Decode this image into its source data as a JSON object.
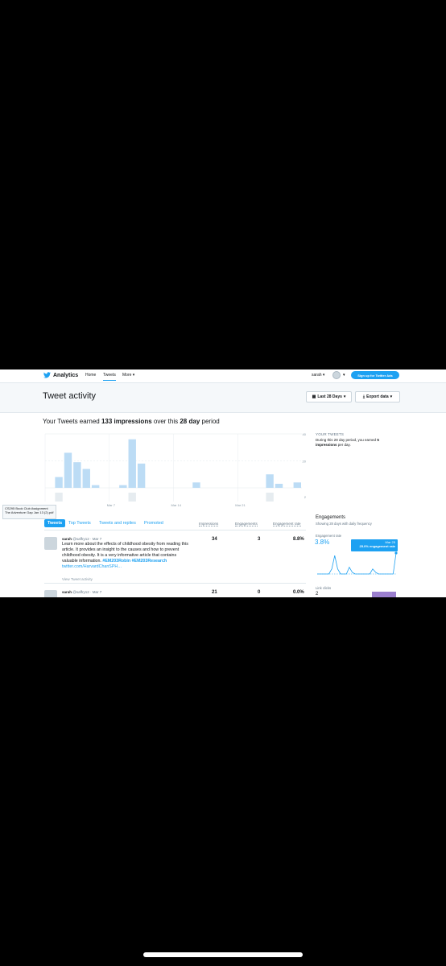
{
  "nav": {
    "brand": "Analytics",
    "links": [
      "Home",
      "Tweets",
      "More"
    ],
    "active_link": "Tweets",
    "user": "sarah",
    "ads_button": "Sign up for Twitter Ads"
  },
  "header": {
    "title": "Tweet activity",
    "date_range": "Last 28 Days",
    "export": "Export data"
  },
  "summary": {
    "prefix": "Your Tweets earned",
    "impressions": "133 impressions",
    "middle": "over this",
    "period": "28 day",
    "suffix": "period"
  },
  "chart_data": {
    "type": "bar",
    "y_ticks": [
      "40",
      "20",
      "2"
    ],
    "x_tick_labels": [
      "Mar 7",
      "Mar 14",
      "Mar 21"
    ],
    "impressions": [
      0,
      8,
      26,
      19,
      14,
      2,
      0,
      0,
      2,
      36,
      18,
      0,
      0,
      0,
      0,
      0,
      4,
      0,
      0,
      0,
      0,
      0,
      0,
      0,
      10,
      3,
      0,
      4
    ],
    "organic_bars": [
      0,
      6,
      0,
      0,
      0,
      0,
      0,
      0,
      0,
      6,
      0,
      0,
      0,
      0,
      0,
      0,
      0,
      0,
      0,
      0,
      0,
      0,
      0,
      0,
      6,
      0,
      0,
      0
    ],
    "ylim": [
      0,
      40
    ],
    "grid": true
  },
  "your_tweets": {
    "heading": "YOUR TWEETS",
    "text_pre": "During this 28 day period, you earned",
    "value": "5 impressions",
    "text_post": "per day."
  },
  "file_tooltip": "CS295 Book Club Assignment The Adventure Gap Jan 13 (2).pdf",
  "tabs": [
    "Tweets",
    "Top Tweets",
    "Tweets and replies",
    "Promoted"
  ],
  "columns": [
    "Impressions",
    "Engagements",
    "Engagement rate"
  ],
  "tweets": [
    {
      "name": "sarah",
      "handle": "@saffry12 · Mar 7",
      "text": "Learn more about the effects of childhood obesity from reading this article. It provides an insight to the causes and how to prevent childhood obesity. It is a very informative article that contains valuable information.",
      "hashtag1": "#EM203Robin",
      "hashtag2": "#EM203Research",
      "link": "twitter.com/HarvardChanSPH…",
      "activity": "View Tweet activity",
      "impressions": "34",
      "engagements": "3",
      "rate": "8.8%"
    },
    {
      "name": "sarah",
      "handle": "@saffry12 · Mar 7",
      "impressions": "21",
      "engagements": "0",
      "rate": "0.0%"
    }
  ],
  "engagements": {
    "heading": "Engagements",
    "sub": "Showing 28 days with daily frequency",
    "rate_label": "Engagement rate",
    "rate": "3.8%",
    "tip_date": "Mar 25",
    "tip_value": "25.0% engagement rate",
    "sparkline": [
      0,
      0,
      0,
      0,
      0,
      6,
      22,
      6,
      0,
      0,
      0,
      8,
      2,
      0,
      0,
      0,
      0,
      0,
      0,
      6,
      2,
      0,
      0,
      0,
      0,
      0,
      0,
      25
    ],
    "link_clicks_label": "Link clicks",
    "link_clicks": "2"
  },
  "colors": {
    "accent": "#1da1f2",
    "bar": "#bcdcf5",
    "organic": "#e6ecf0"
  }
}
